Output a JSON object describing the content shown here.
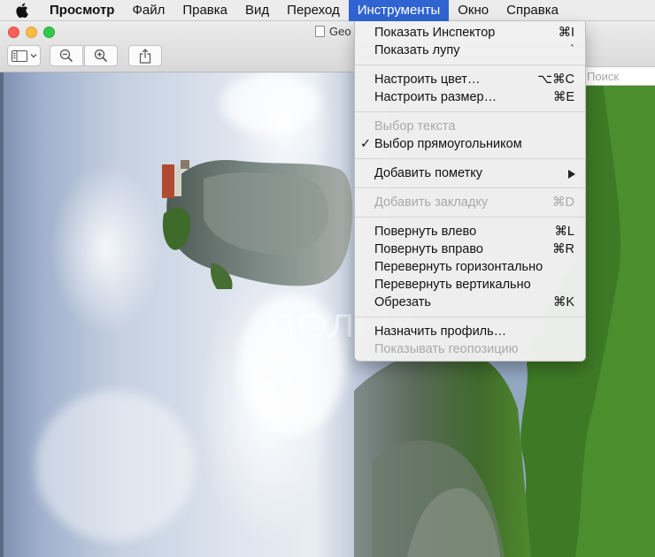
{
  "menubar": {
    "apple_icon": "apple-logo",
    "app_name": "Просмотр",
    "items": [
      "Файл",
      "Правка",
      "Вид",
      "Переход",
      "Инструменты",
      "Окно",
      "Справка"
    ],
    "active_index": 4,
    "active_color": "#2f64d2"
  },
  "window": {
    "title": "Geo",
    "search_placeholder": "Поиск",
    "toolbar": {
      "sidebar_icon": "sidebar-icon",
      "zoom_out_icon": "zoom-out-icon",
      "zoom_in_icon": "zoom-in-icon",
      "share_icon": "share-icon"
    }
  },
  "photo": {
    "watermark": "ЯОЛЫК"
  },
  "tools_menu": {
    "items": [
      {
        "label": "Показать Инспектор",
        "shortcut": "⌘I"
      },
      {
        "label": "Показать лупу",
        "shortcut": "`"
      },
      {
        "separator": true
      },
      {
        "label": "Настроить цвет…",
        "shortcut": "⌥⌘C"
      },
      {
        "label": "Настроить размер…",
        "shortcut": "⌘E"
      },
      {
        "separator": true
      },
      {
        "label": "Выбор текста",
        "disabled": true
      },
      {
        "label": "Выбор прямоугольником",
        "checked": true
      },
      {
        "separator": true
      },
      {
        "label": "Добавить пометку",
        "submenu": true
      },
      {
        "separator": true
      },
      {
        "label": "Добавить закладку",
        "shortcut": "⌘D",
        "disabled": true
      },
      {
        "separator": true
      },
      {
        "label": "Повернуть влево",
        "shortcut": "⌘L"
      },
      {
        "label": "Повернуть вправо",
        "shortcut": "⌘R"
      },
      {
        "label": "Перевернуть горизонтально"
      },
      {
        "label": "Перевернуть вертикально"
      },
      {
        "label": "Обрезать",
        "shortcut": "⌘K"
      },
      {
        "separator": true
      },
      {
        "label": "Назначить профиль…"
      },
      {
        "label": "Показывать геопозицию",
        "disabled": true
      }
    ],
    "check_mark": "✓"
  }
}
